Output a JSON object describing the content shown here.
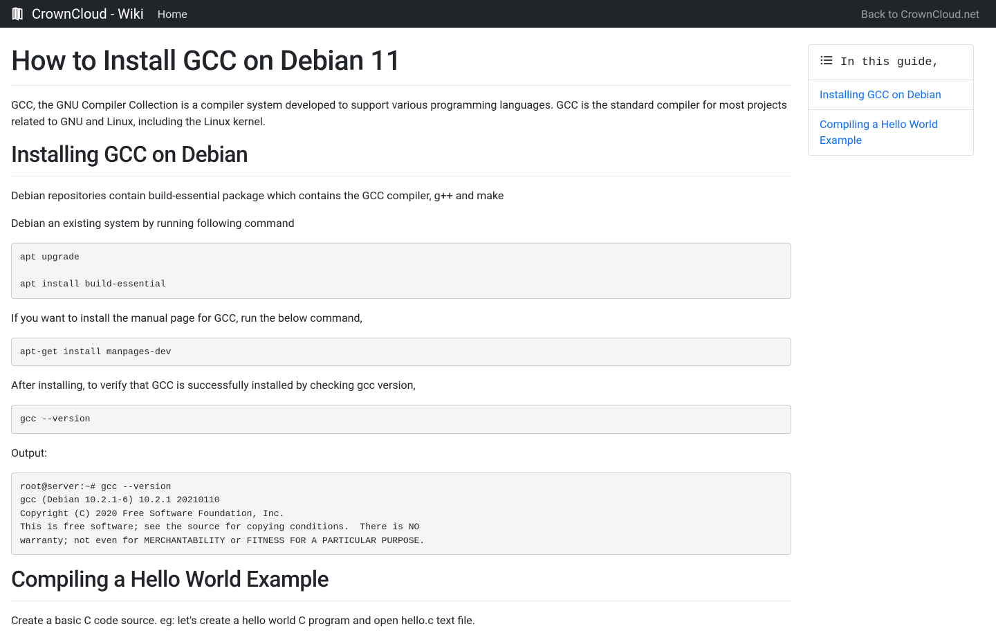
{
  "navbar": {
    "brand": "CrownCloud - Wiki",
    "home": "Home",
    "back": "Back to CrownCloud.net"
  },
  "page": {
    "title": "How to Install GCC on Debian 11",
    "intro": "GCC, the GNU Compiler Collection is a compiler system developed to support various programming languages. GCC is the standard compiler for most projects related to GNU and Linux, including the Linux kernel.",
    "section1_title": "Installing GCC on Debian",
    "p1": "Debian repositories contain build-essential package which contains the GCC compiler, g++ and make",
    "p2": "Debian an existing system by running following command",
    "code1": "apt upgrade\n\napt install build-essential",
    "p3": "If you want to install the manual page for GCC, run the below command,",
    "code2": "apt-get install manpages-dev",
    "p4": "After installing, to verify that GCC is successfully installed by checking gcc version,",
    "code3": "gcc --version",
    "p5": "Output:",
    "code4": "root@server:~# gcc --version\ngcc (Debian 10.2.1-6) 10.2.1 20210110\nCopyright (C) 2020 Free Software Foundation, Inc.\nThis is free software; see the source for copying conditions.  There is NO\nwarranty; not even for MERCHANTABILITY or FITNESS FOR A PARTICULAR PURPOSE.",
    "section2_title": "Compiling a Hello World Example",
    "p6": "Create a basic C code source. eg: let's create a hello world C program and open hello.c text file."
  },
  "toc": {
    "header": "In this guide,",
    "items": [
      "Installing GCC on Debian",
      "Compiling a Hello World Example"
    ]
  }
}
